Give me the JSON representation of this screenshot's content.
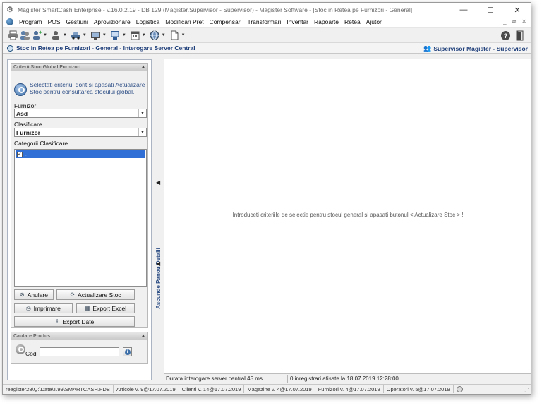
{
  "window": {
    "title": "Magister SmartCash Enterprise - v.16.0.2.19 - DB 129 (Magister.Supervisor - Supervisor) - Magister Software - [Stoc in Retea pe Furnizori - General]",
    "minimize": "—",
    "maximize": "☐",
    "close": "✕"
  },
  "menu": {
    "items": [
      "Program",
      "POS",
      "Gestiuni",
      "Aprovizionare",
      "Logistica",
      "Modificari Pret",
      "Compensari",
      "Transformari",
      "Inventar",
      "Rapoarte",
      "Retea",
      "Ajutor"
    ],
    "mdi": [
      "_",
      "⧉",
      "✕"
    ]
  },
  "toolbar": {
    "icons": [
      "print-icon",
      "users-icon",
      "user-add-icon",
      "user-icon",
      "cars-icon",
      "monitor-icon",
      "screen-icon",
      "calendar-icon",
      "globe-icon",
      "document-icon"
    ],
    "right_icons": [
      "help-icon",
      "exit-icon"
    ]
  },
  "breadcrumb": {
    "text": "Stoc in Retea pe Furnizori - General - Interogare Server Central",
    "user": "Supervisor Magister - Supervisor"
  },
  "criteria": {
    "header": "Criterii Stoc Global Furnizori",
    "info": "Selectati criteriul dorit si apasati Actualizare Stoc pentru consultarea stocului global.",
    "supplier_label": "Furnizor",
    "supplier_value": "Asd",
    "classification_label": "Clasificare",
    "classification_value": "Furnizor",
    "categories_label": "Categorii Clasificare",
    "categories": [
      {
        "checked": true,
        "label": "-"
      }
    ],
    "buttons": {
      "cancel": "Anulare",
      "refresh": "Actualizare Stoc",
      "print": "Imprimare",
      "export_excel": "Export Excel",
      "export_date": "Export Date"
    }
  },
  "code_search": {
    "header": "Cautare Produs",
    "label": "Cod",
    "value": ""
  },
  "splitter": {
    "label": "Ascunde Panou Detalii"
  },
  "main": {
    "message": "Introduceti criteriile de selectie pentru stocul general si apasati butonul < Actualizare Stoc > !"
  },
  "inner_status": {
    "duration": "Durata interogare server central 45 ms.",
    "records": "0 inregistrari afisate la 18.07.2019 12:28:00."
  },
  "statusbar": {
    "db": "reagister28\\Q:\\Date\\T.99\\SMARTCASH.FDB",
    "articles": "Articole v. 9@17.07.2019",
    "clients": "Clienti v. 14@17.07.2019",
    "stores": "Magazine v. 4@17.07.2019",
    "suppliers": "Furnizori v. 4@17.07.2019",
    "operators": "Operatori v. 5@17.07.2019"
  }
}
